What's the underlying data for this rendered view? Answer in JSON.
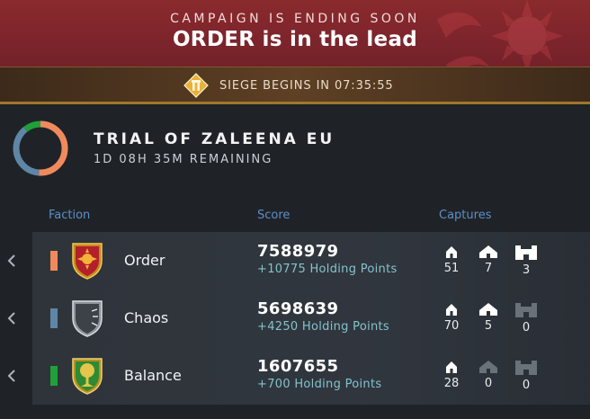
{
  "banner": {
    "kicker": "CAMPAIGN IS ENDING SOON",
    "title": "ORDER is in the lead"
  },
  "siege": {
    "icon": "siege-emblem-icon",
    "text": "SIEGE BEGINS IN 07:35:55"
  },
  "campaign": {
    "name": "TRIAL OF ZALEENA EU",
    "remaining": "1D 08H 35M REMAINING"
  },
  "columns": {
    "faction": "Faction",
    "score": "Score",
    "captures": "Captures"
  },
  "factions": [
    {
      "name": "Order",
      "color": "#f08a5d",
      "emblem": "order-shield-icon",
      "score": "7588979",
      "holding": "+10775 Holding Points",
      "captures": [
        "51",
        "7",
        "3"
      ]
    },
    {
      "name": "Chaos",
      "color": "#5f86a6",
      "emblem": "chaos-shield-icon",
      "score": "5698639",
      "holding": "+4250 Holding Points",
      "captures": [
        "70",
        "5",
        "0"
      ]
    },
    {
      "name": "Balance",
      "color": "#1fa038",
      "emblem": "balance-shield-icon",
      "score": "1607655",
      "holding": "+700 Holding Points",
      "captures": [
        "28",
        "0",
        "0"
      ]
    }
  ],
  "colors": {
    "banner": "#8a2a2d",
    "siege_border": "#a1762b",
    "header_blue": "#5d8fc7",
    "holding_text": "#84c2cc"
  }
}
